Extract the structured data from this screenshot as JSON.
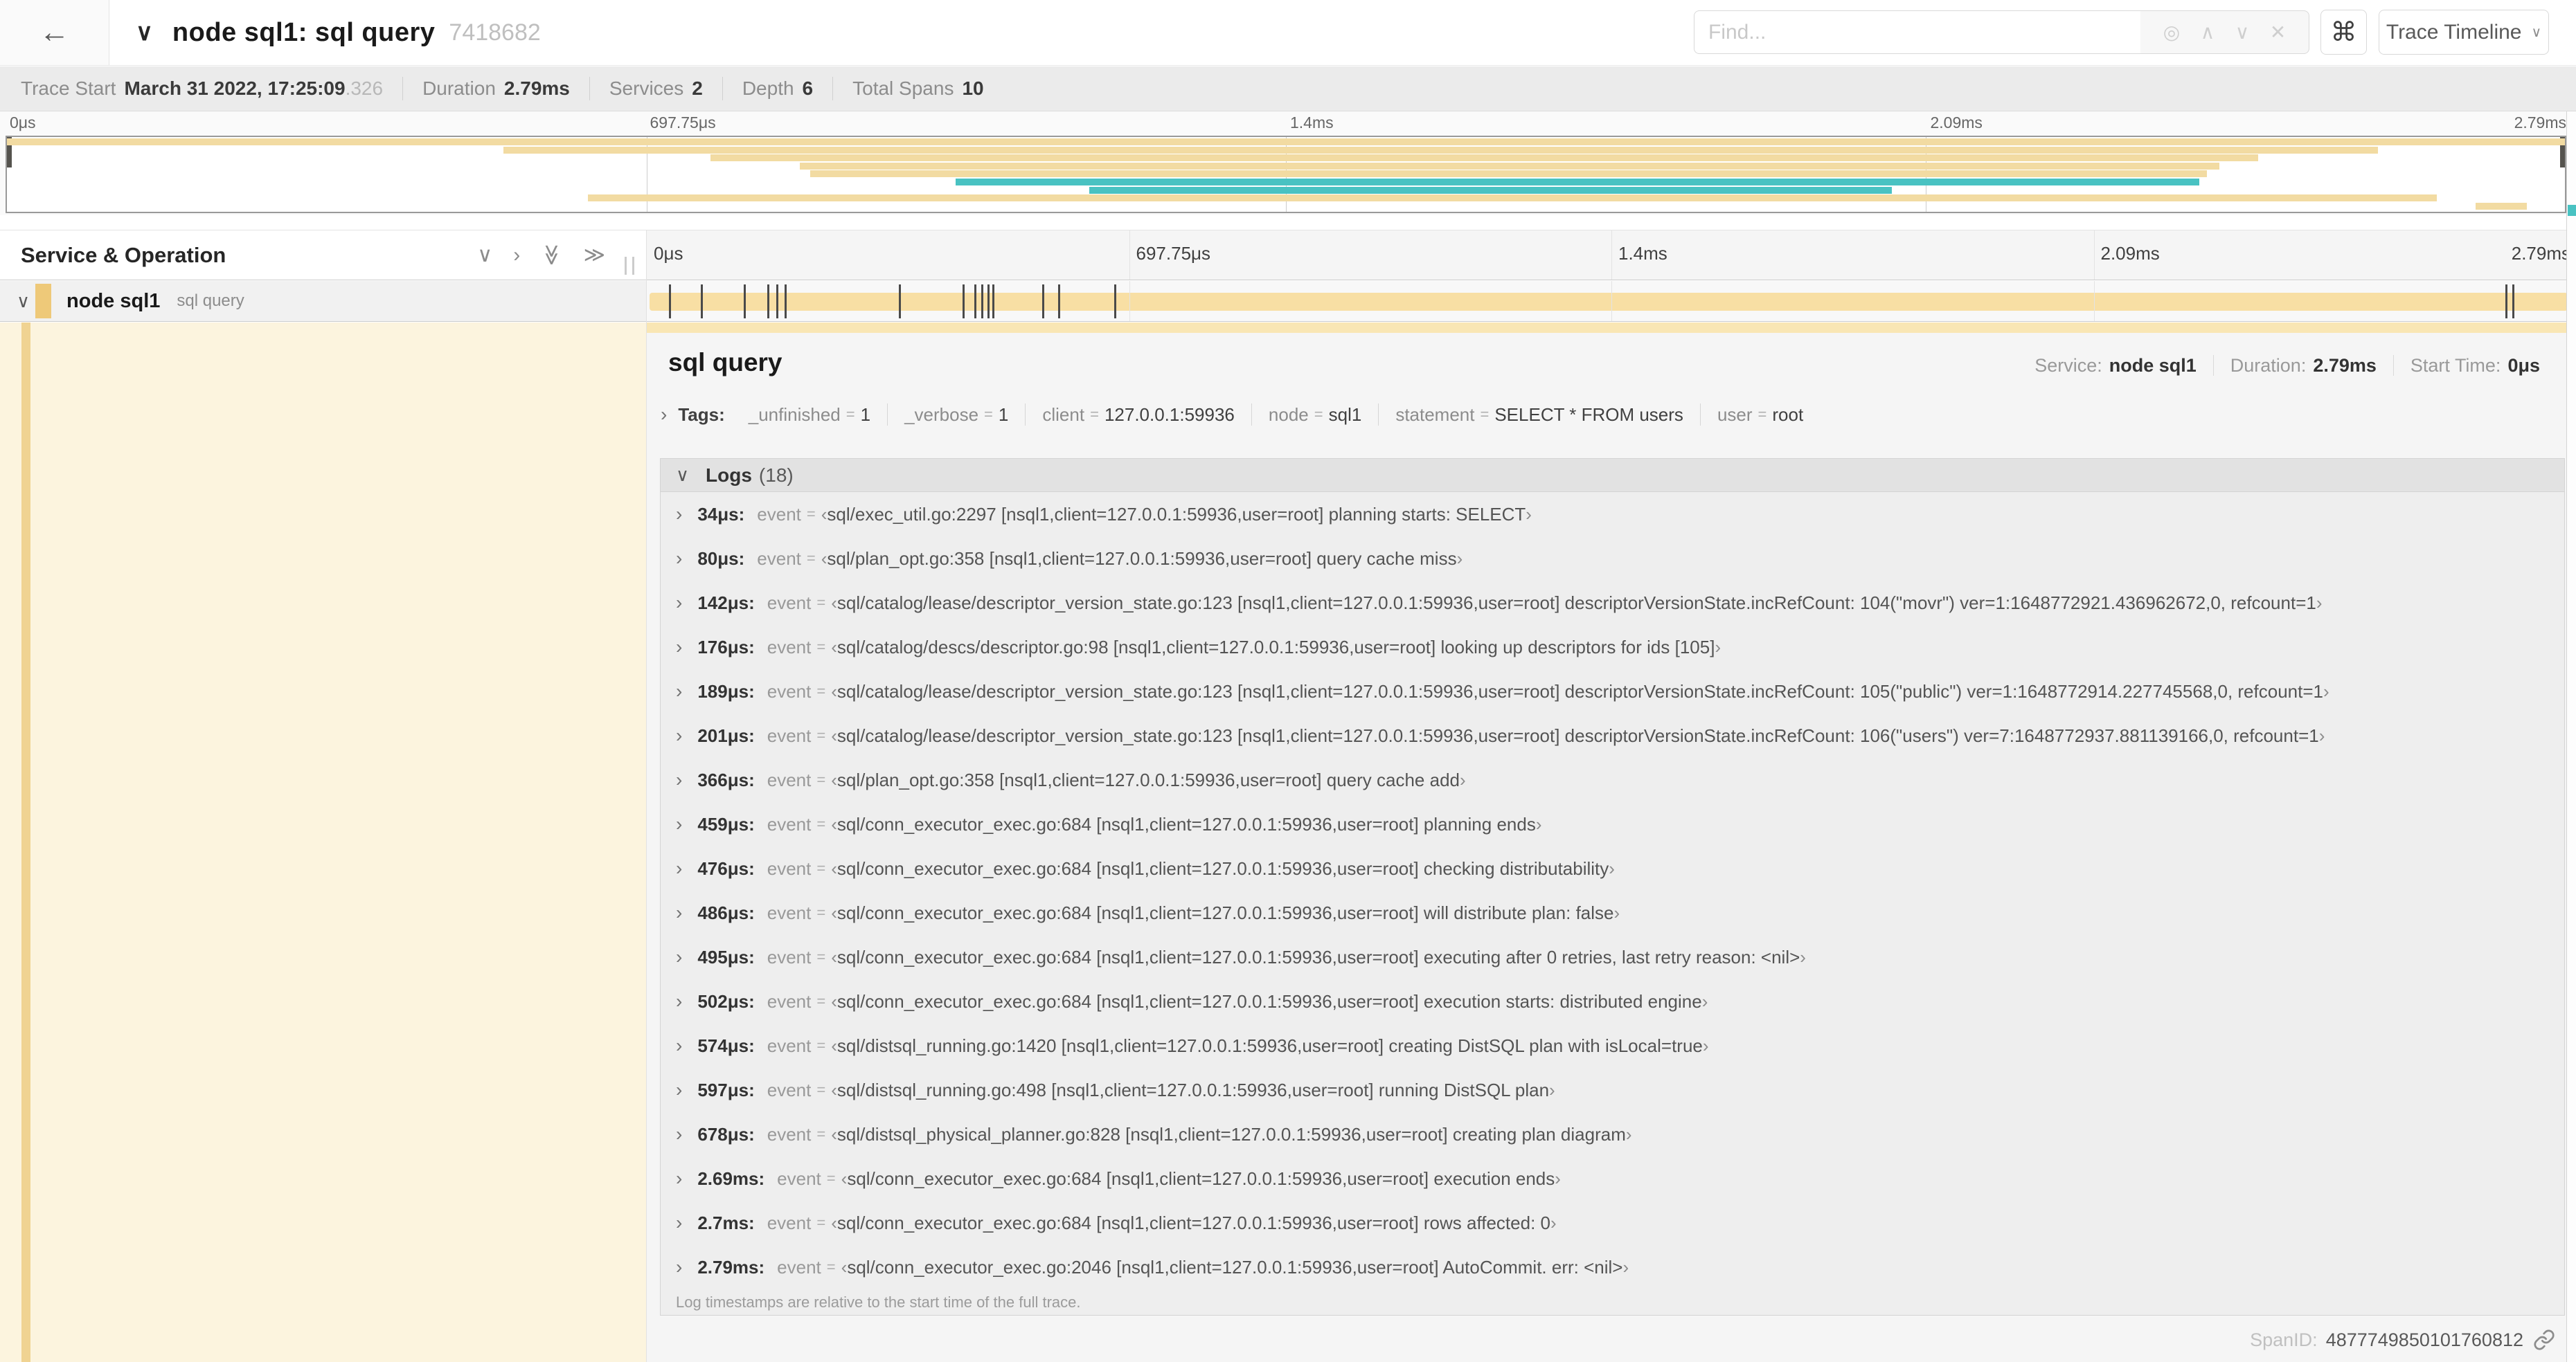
{
  "icons": {
    "back": "←",
    "collapse": "∨",
    "locate": "◎",
    "prev": "∧",
    "next": "∨",
    "clear": "✕",
    "command": "⌘",
    "caret": "∨",
    "chevron_down": "∨",
    "chevron_right": "›",
    "dbl_chevron_down": "≫",
    "dbl_chevron_right": "≫"
  },
  "header": {
    "title": "node sql1: sql query",
    "trace_id": "7418682",
    "find_placeholder": "Find...",
    "view_selector": "Trace Timeline"
  },
  "summary": [
    {
      "label": "Trace Start",
      "value": "March 31 2022, 17:25:09",
      "suffix": ".326"
    },
    {
      "label": "Duration",
      "value": "2.79ms",
      "suffix": ""
    },
    {
      "label": "Services",
      "value": "2",
      "suffix": ""
    },
    {
      "label": "Depth",
      "value": "6",
      "suffix": ""
    },
    {
      "label": "Total Spans",
      "value": "10",
      "suffix": ""
    }
  ],
  "timeline": {
    "ticks": [
      "0μs",
      "697.75μs",
      "1.4ms",
      "2.09ms",
      "2.79ms"
    ],
    "column_header": "Service & Operation",
    "gridlines_pct": [
      25,
      50,
      75
    ]
  },
  "colors": {
    "tan": "#f2dba2",
    "teal": "#49c2c2",
    "bar": "#f8dfa4",
    "marker": "#4a4a4a"
  },
  "minimap": {
    "spans": [
      {
        "row": 0,
        "start": 0,
        "end": 100,
        "color": "tan"
      },
      {
        "row": 1,
        "start": 19.4,
        "end": 92.7,
        "color": "tan"
      },
      {
        "row": 2,
        "start": 27.5,
        "end": 88,
        "color": "tan"
      },
      {
        "row": 3,
        "start": 31,
        "end": 86.5,
        "color": "tan"
      },
      {
        "row": 4,
        "start": 31.4,
        "end": 86,
        "color": "tan"
      },
      {
        "row": 5,
        "start": 37.1,
        "end": 85.7,
        "color": "teal"
      },
      {
        "row": 6,
        "start": 42.3,
        "end": 73.7,
        "color": "teal"
      },
      {
        "row": 7,
        "start": 22.7,
        "end": 95,
        "color": "tan"
      },
      {
        "row": 8,
        "start": 96.5,
        "end": 98.5,
        "color": "tan"
      }
    ]
  },
  "row": {
    "service": "node sql1",
    "operation": "sql query",
    "markers_pct": [
      1.22,
      2.87,
      5.09,
      6.31,
      6.77,
      7.2,
      13.12,
      16.45,
      17.06,
      17.42,
      17.74,
      17.99,
      20.57,
      21.4,
      24.3,
      96.42,
      96.77,
      100
    ]
  },
  "detail": {
    "title": "sql query",
    "info": [
      {
        "label": "Service:",
        "value": "node sql1"
      },
      {
        "label": "Duration:",
        "value": "2.79ms"
      },
      {
        "label": "Start Time:",
        "value": "0μs"
      }
    ],
    "tags_label": "Tags:",
    "tags": [
      {
        "key": "_unfinished",
        "value": "1"
      },
      {
        "key": "_verbose",
        "value": "1"
      },
      {
        "key": "client",
        "value": "127.0.0.1:59936"
      },
      {
        "key": "node",
        "value": "sql1"
      },
      {
        "key": "statement",
        "value": "SELECT * FROM users"
      },
      {
        "key": "user",
        "value": "root"
      }
    ],
    "logs_label": "Logs",
    "logs_count": "(18)",
    "logs": [
      {
        "time": "34μs:",
        "field": "event",
        "event": "sql/exec_util.go:2297 [nsql1,client=127.0.0.1:59936,user=root] planning starts: SELECT"
      },
      {
        "time": "80μs:",
        "field": "event",
        "event": "sql/plan_opt.go:358 [nsql1,client=127.0.0.1:59936,user=root] query cache miss"
      },
      {
        "time": "142μs:",
        "field": "event",
        "event": "sql/catalog/lease/descriptor_version_state.go:123 [nsql1,client=127.0.0.1:59936,user=root] descriptorVersionState.incRefCount: 104(\"movr\") ver=1:1648772921.436962672,0, refcount=1"
      },
      {
        "time": "176μs:",
        "field": "event",
        "event": "sql/catalog/descs/descriptor.go:98 [nsql1,client=127.0.0.1:59936,user=root] looking up descriptors for ids [105]"
      },
      {
        "time": "189μs:",
        "field": "event",
        "event": "sql/catalog/lease/descriptor_version_state.go:123 [nsql1,client=127.0.0.1:59936,user=root] descriptorVersionState.incRefCount: 105(\"public\") ver=1:1648772914.227745568,0, refcount=1"
      },
      {
        "time": "201μs:",
        "field": "event",
        "event": "sql/catalog/lease/descriptor_version_state.go:123 [nsql1,client=127.0.0.1:59936,user=root] descriptorVersionState.incRefCount: 106(\"users\") ver=7:1648772937.881139166,0, refcount=1"
      },
      {
        "time": "366μs:",
        "field": "event",
        "event": "sql/plan_opt.go:358 [nsql1,client=127.0.0.1:59936,user=root] query cache add"
      },
      {
        "time": "459μs:",
        "field": "event",
        "event": "sql/conn_executor_exec.go:684 [nsql1,client=127.0.0.1:59936,user=root] planning ends"
      },
      {
        "time": "476μs:",
        "field": "event",
        "event": "sql/conn_executor_exec.go:684 [nsql1,client=127.0.0.1:59936,user=root] checking distributability"
      },
      {
        "time": "486μs:",
        "field": "event",
        "event": "sql/conn_executor_exec.go:684 [nsql1,client=127.0.0.1:59936,user=root] will distribute plan: false"
      },
      {
        "time": "495μs:",
        "field": "event",
        "event": "sql/conn_executor_exec.go:684 [nsql1,client=127.0.0.1:59936,user=root] executing after 0 retries, last retry reason: <nil>"
      },
      {
        "time": "502μs:",
        "field": "event",
        "event": "sql/conn_executor_exec.go:684 [nsql1,client=127.0.0.1:59936,user=root] execution starts: distributed engine"
      },
      {
        "time": "574μs:",
        "field": "event",
        "event": "sql/distsql_running.go:1420 [nsql1,client=127.0.0.1:59936,user=root] creating DistSQL plan with isLocal=true"
      },
      {
        "time": "597μs:",
        "field": "event",
        "event": "sql/distsql_running.go:498 [nsql1,client=127.0.0.1:59936,user=root] running DistSQL plan"
      },
      {
        "time": "678μs:",
        "field": "event",
        "event": "sql/distsql_physical_planner.go:828 [nsql1,client=127.0.0.1:59936,user=root] creating plan diagram"
      },
      {
        "time": "2.69ms:",
        "field": "event",
        "event": "sql/conn_executor_exec.go:684 [nsql1,client=127.0.0.1:59936,user=root] execution ends"
      },
      {
        "time": "2.7ms:",
        "field": "event",
        "event": "sql/conn_executor_exec.go:684 [nsql1,client=127.0.0.1:59936,user=root] rows affected: 0"
      },
      {
        "time": "2.79ms:",
        "field": "event",
        "event": "sql/conn_executor_exec.go:2046 [nsql1,client=127.0.0.1:59936,user=root] AutoCommit. err: <nil>"
      }
    ],
    "logs_note": "Log timestamps are relative to the start time of the full trace.",
    "span_id_label": "SpanID:",
    "span_id": "4877749850101760812"
  }
}
